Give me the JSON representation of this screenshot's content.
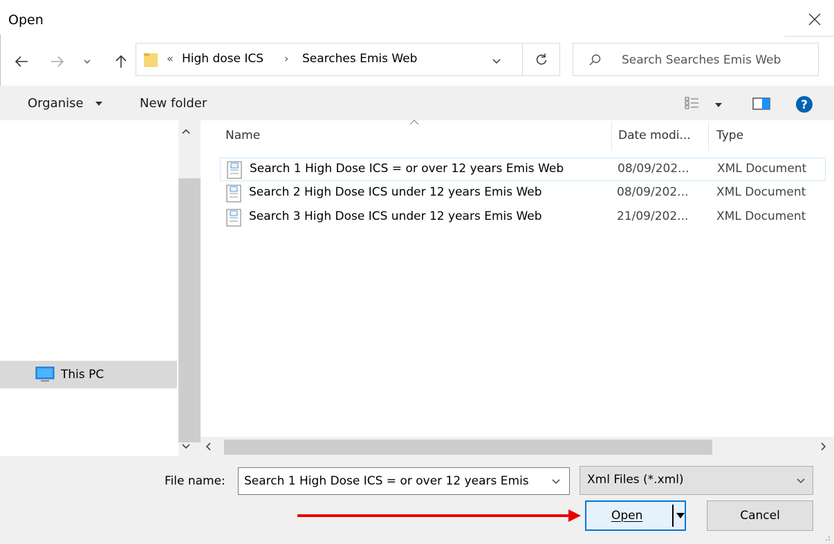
{
  "window": {
    "title": "Open",
    "close_icon": "close-icon"
  },
  "nav": {
    "back_icon": "arrow-left-icon",
    "forward_icon": "arrow-right-icon",
    "recent_icon": "chevron-down-icon",
    "up_icon": "arrow-up-icon",
    "breadcrumb_overflow": "«",
    "breadcrumb": [
      "High dose ICS",
      "Searches Emis Web"
    ],
    "breadcrumb_separator": "›",
    "refresh_icon": "refresh-icon",
    "search_placeholder": "Search Searches Emis Web"
  },
  "toolbar": {
    "organise_label": "Organise",
    "new_folder_label": "New folder",
    "view_icon": "view-options-icon",
    "preview_icon": "preview-pane-icon",
    "help_icon": "help-icon",
    "help_color": "#0063b1"
  },
  "sidebar": {
    "items": [
      {
        "label": "This PC",
        "icon": "computer-icon",
        "selected": true
      }
    ]
  },
  "file_list": {
    "columns": [
      "Name",
      "Date modi...",
      "Type"
    ],
    "rows": [
      {
        "name": "Search 1 High Dose ICS = or over 12 years Emis Web",
        "date": "08/09/202...",
        "type": "XML Document",
        "selected": true
      },
      {
        "name": "Search 2 High Dose ICS under 12 years Emis Web",
        "date": "08/09/202...",
        "type": "XML Document",
        "selected": false
      },
      {
        "name": "Search 3 High Dose ICS under 12 years Emis Web",
        "date": "21/09/202...",
        "type": "XML Document",
        "selected": false
      }
    ]
  },
  "bottom": {
    "file_name_label": "File name:",
    "file_name_value": "Search 1 High Dose ICS = or over 12 years Emis",
    "file_type_value": "Xml Files (*.xml)",
    "open_label": "Open",
    "cancel_label": "Cancel",
    "accent_color": "#0078d7",
    "annotation_arrow_color": "#e60000"
  }
}
